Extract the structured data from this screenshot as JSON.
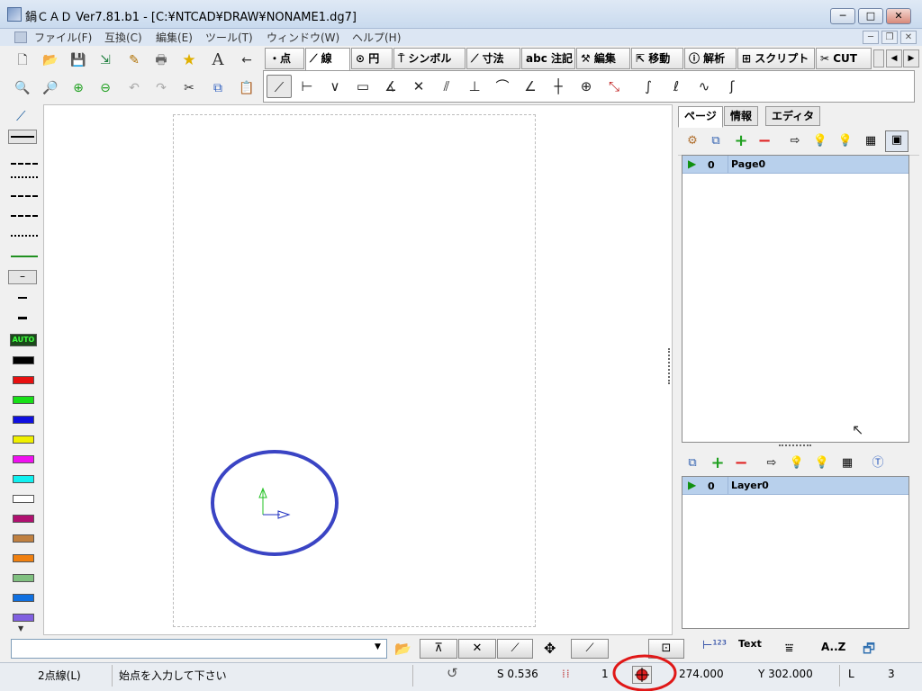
{
  "window": {
    "title": "鍋ＣＡＤ Ver7.81.b1 - [C:¥NTCAD¥DRAW¥NONAME1.dg7]",
    "minimize": "─",
    "maximize": "□",
    "close": "✕"
  },
  "menu": [
    "ファイル(F)",
    "互換(C)",
    "編集(E)",
    "ツール(T)",
    "ウィンドウ(W)",
    "ヘルプ(H)"
  ],
  "mode_tabs": [
    {
      "label": "・点"
    },
    {
      "label": "⟋ 線",
      "active": true
    },
    {
      "label": "⊙ 円"
    },
    {
      "label": "⍑ シンボル"
    },
    {
      "label": "⟋ 寸法"
    },
    {
      "label": "abc 注記"
    },
    {
      "label": "⚒ 編集"
    },
    {
      "label": "⇱ 移動"
    },
    {
      "label": "ⓘ 解析"
    },
    {
      "label": "⊞ スクリプト"
    },
    {
      "label": "✂ CUT"
    }
  ],
  "left_palette": {
    "auto_label": "AUTO",
    "colors": [
      "#000000",
      "#e81010",
      "#18e018",
      "#1010e0",
      "#f0f000",
      "#f010f0",
      "#10f0f0",
      "#ffffff",
      "#b01070",
      "#c08040",
      "#f08010",
      "#80c080",
      "#1070e0",
      "#8060e0"
    ]
  },
  "right_panel": {
    "tabs": [
      "ページ",
      "情報",
      "エディタ"
    ],
    "active_tab": "ページ",
    "pages": [
      {
        "number": "0",
        "name": "Page0"
      }
    ],
    "layers": [
      {
        "number": "0",
        "name": "Layer0"
      }
    ]
  },
  "command_bar": {
    "input_value": "",
    "text_button": "Text",
    "az_button": "A..Z"
  },
  "status_bar": {
    "mode": "2点線(L)",
    "prompt": "始点を入力して下さい",
    "scale": "S 0.536",
    "grid_count": "1",
    "x": "274.000",
    "y": "Y 302.000",
    "l_label": "L",
    "l_value": "3"
  },
  "colors": {
    "circle_stroke": "#3a44c4",
    "highlight_ring": "#e01818",
    "axis_y": "#20c020",
    "axis_x": "#2030c0"
  }
}
